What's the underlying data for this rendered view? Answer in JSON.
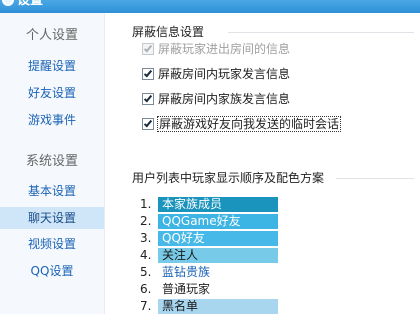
{
  "window": {
    "title": "设置"
  },
  "sidebar": {
    "groups": [
      {
        "label": "个人设置",
        "items": [
          "提醒设置",
          "好友设置",
          "游戏事件"
        ]
      },
      {
        "label": "系统设置",
        "items": [
          "基本设置",
          "聊天设置",
          "视频设置",
          "QQ设置"
        ]
      }
    ],
    "active_item": "聊天设置"
  },
  "block_section": {
    "title": "屏蔽信息设置",
    "options": [
      {
        "label": "屏蔽玩家进出房间的信息",
        "checked": true,
        "disabled": true
      },
      {
        "label": "屏蔽房间内玩家发言信息",
        "checked": true,
        "disabled": false
      },
      {
        "label": "屏蔽房间内家族发言信息",
        "checked": true,
        "disabled": false
      },
      {
        "label": "屏蔽游戏好友向我发送的临时会话",
        "checked": true,
        "disabled": false,
        "focused": true
      }
    ]
  },
  "order_section": {
    "title": "用户列表中玩家显示顺序及配色方案",
    "entries": [
      {
        "num": "1.",
        "label": "本家族成员",
        "bg": "#1a93bd",
        "fg": "#ffffff"
      },
      {
        "num": "2.",
        "label": "QQGame好友",
        "bg": "#3cb4e4",
        "fg": "#ffffff"
      },
      {
        "num": "3.",
        "label": "QQ好友",
        "bg": "#47b9e8",
        "fg": "#ffffff"
      },
      {
        "num": "4.",
        "label": "关注人",
        "bg": "#78cbe8",
        "fg": "#1a1a1a"
      },
      {
        "num": "5.",
        "label": "蓝钻贵族",
        "bg": "",
        "fg": "#1a62b6"
      },
      {
        "num": "6.",
        "label": "普通玩家",
        "bg": "",
        "fg": "#222222"
      },
      {
        "num": "7.",
        "label": "黑名单",
        "bg": "#a8d6ee",
        "fg": "#1a1a1a"
      }
    ]
  }
}
